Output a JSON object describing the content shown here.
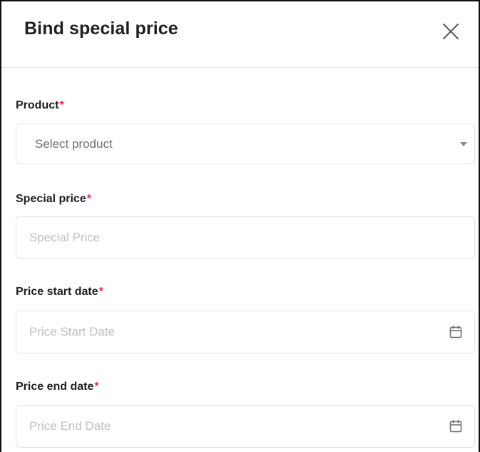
{
  "dialog": {
    "title": "Bind special price",
    "close_icon": "close-icon"
  },
  "form": {
    "product": {
      "label": "Product",
      "required_mark": "*",
      "value": "Select product",
      "icon": "chevron-down-icon"
    },
    "special_price": {
      "label": "Special price",
      "required_mark": "*",
      "placeholder": "Special Price"
    },
    "price_start_date": {
      "label": "Price start date",
      "required_mark": "*",
      "placeholder": "Price Start Date",
      "icon": "calendar-icon"
    },
    "price_end_date": {
      "label": "Price end date",
      "required_mark": "*",
      "placeholder": "Price End Date",
      "icon": "calendar-icon"
    }
  },
  "colors": {
    "required": "#e6226b",
    "border": "#e2e2e2",
    "placeholder": "#c0c0c0"
  }
}
